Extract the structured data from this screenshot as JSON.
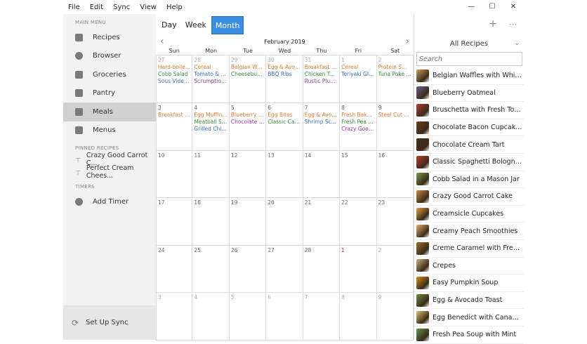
{
  "menu": [
    "File",
    "Edit",
    "Sync",
    "View",
    "Help"
  ],
  "window_controls": [
    "—",
    "☐",
    "✕"
  ],
  "sidebar": {
    "main_menu_label": "MAIN MENU",
    "items": [
      {
        "label": "Recipes",
        "icon": "book-icon"
      },
      {
        "label": "Browser",
        "icon": "compass-icon"
      },
      {
        "label": "Groceries",
        "icon": "cart-icon"
      },
      {
        "label": "Pantry",
        "icon": "apple-icon"
      },
      {
        "label": "Meals",
        "icon": "calendar-icon"
      },
      {
        "label": "Menus",
        "icon": "menu-book-icon"
      }
    ],
    "pinned_label": "PINNED RECIPES",
    "pinned": [
      "Crazy Good Carrot C...",
      "Perfect Cream Chees..."
    ],
    "timers_label": "TIMERS",
    "add_timer": "Add Timer",
    "sync": "Set Up Sync"
  },
  "views": [
    "Day",
    "Week",
    "Month"
  ],
  "active_view": "Month",
  "calendar": {
    "month": "February 2019",
    "dow": [
      "Sun",
      "Mon",
      "Tue",
      "Wed",
      "Thu",
      "Fri",
      "Sat"
    ],
    "weeks": [
      [
        {
          "d": "27",
          "t": "grey",
          "e": [
            [
              "b",
              "Hard-boiled..."
            ],
            [
              "l",
              "Cobb Salad"
            ],
            [
              "d",
              "Sous Vide St..."
            ]
          ]
        },
        {
          "d": "28",
          "t": "grey",
          "e": [
            [
              "b",
              "Cereal"
            ],
            [
              "d",
              "Tomato & M..."
            ],
            [
              "s",
              "Scrumptious..."
            ]
          ]
        },
        {
          "d": "29",
          "t": "grey",
          "e": [
            [
              "b",
              "Belgian Waff..."
            ],
            [
              "l",
              "Cheeseburger"
            ]
          ]
        },
        {
          "d": "30",
          "t": "grey",
          "e": [
            [
              "b",
              "Egg & Avoca..."
            ],
            [
              "d",
              "BBQ Ribs"
            ]
          ]
        },
        {
          "d": "31",
          "t": "grey",
          "e": [
            [
              "b",
              "Breakfast Bu..."
            ],
            [
              "l",
              "Chicken Teri..."
            ],
            [
              "s",
              "Rustic Plum..."
            ]
          ]
        },
        {
          "d": "1",
          "t": "grey",
          "e": [
            [
              "b",
              "Cereal"
            ],
            [
              "d",
              "Teriyaki Glaz..."
            ]
          ]
        },
        {
          "d": "2",
          "t": "grey",
          "e": [
            [
              "b",
              "Protein Smo..."
            ],
            [
              "l",
              "Tuna Poke B..."
            ]
          ]
        }
      ],
      [
        {
          "d": "3",
          "e": [
            [
              "b",
              "Breakfast Bu..."
            ]
          ]
        },
        {
          "d": "4",
          "e": [
            [
              "b",
              "Egg Muffin S..."
            ],
            [
              "l",
              "Meatball Sub"
            ],
            [
              "d",
              "Grilled Chick..."
            ]
          ]
        },
        {
          "d": "5",
          "e": [
            [
              "b",
              "Blueberry Oa..."
            ],
            [
              "s",
              "Chocolate B..."
            ]
          ]
        },
        {
          "d": "6",
          "e": [
            [
              "b",
              "Egg Bites"
            ],
            [
              "l",
              "Classic Caes..."
            ]
          ]
        },
        {
          "d": "7",
          "e": [
            [
              "b",
              "Egg & Avoca..."
            ],
            [
              "d",
              "Shrimp Sca..."
            ]
          ]
        },
        {
          "d": "8",
          "e": [
            [
              "b",
              "Fresh Baked..."
            ],
            [
              "l",
              "Fresh Pea So..."
            ],
            [
              "s",
              "Crazy Good..."
            ]
          ]
        },
        {
          "d": "9",
          "e": [
            [
              "b",
              "Steel Cut Oats"
            ]
          ]
        }
      ],
      [
        {
          "d": "10"
        },
        {
          "d": "11"
        },
        {
          "d": "12"
        },
        {
          "d": "13"
        },
        {
          "d": "14"
        },
        {
          "d": "15"
        },
        {
          "d": "16"
        }
      ],
      [
        {
          "d": "17"
        },
        {
          "d": "18"
        },
        {
          "d": "19"
        },
        {
          "d": "20"
        },
        {
          "d": "21"
        },
        {
          "d": "22"
        },
        {
          "d": "23"
        }
      ],
      [
        {
          "d": "24"
        },
        {
          "d": "25"
        },
        {
          "d": "26"
        },
        {
          "d": "27"
        },
        {
          "d": "28"
        },
        {
          "d": "1",
          "t": "red"
        },
        {
          "d": "2",
          "t": "grey"
        }
      ],
      [
        {
          "d": "3",
          "t": "grey"
        },
        {
          "d": "4",
          "t": "grey"
        },
        {
          "d": "5",
          "t": "grey"
        },
        {
          "d": "6",
          "t": "grey"
        },
        {
          "d": "7",
          "t": "grey"
        },
        {
          "d": "8",
          "t": "grey"
        },
        {
          "d": "9",
          "t": "grey"
        }
      ]
    ]
  },
  "right": {
    "filter": "All Recipes",
    "search_placeholder": "Search",
    "recipes": [
      "Belgian Waffles with Whipp...",
      "Blueberry Oatmeal",
      "Bruschetta with Fresh Toma...",
      "Chocolate Bacon Cupcakes...",
      "Chocolate Cream Tart",
      "Classic Spaghetti Bolognese",
      "Cobb Salad in a Mason Jar",
      "Crazy Good Carrot Cake",
      "Creamsicle Cupcakes",
      "Creamy Peach Smoothies",
      "Creme Caramel with Fresh...",
      "Crepes",
      "Easy Pumpkin Soup",
      "Egg & Avocado Toast",
      "Egg Benedict with Canadia...",
      "Fresh Pea Soup with Mint"
    ]
  },
  "colors": {
    "accent": "#3b8ee0",
    "breakfast": "#e07b30",
    "lunch": "#3c8a3c",
    "dinner": "#3a6fc4",
    "snack": "#8a3a9a"
  }
}
